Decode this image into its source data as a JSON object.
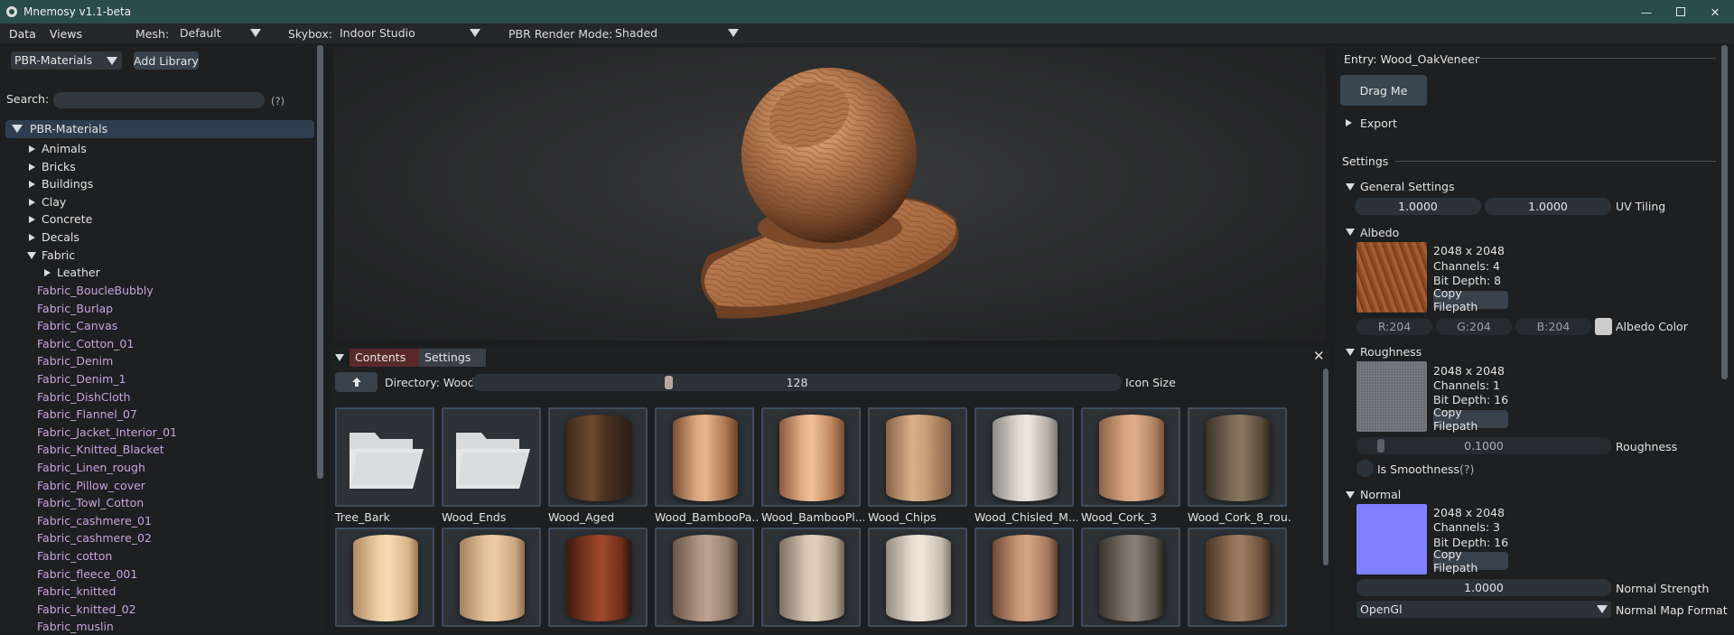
{
  "window": {
    "title": "Mnemosy v1.1-beta"
  },
  "menubar": {
    "data_label": "Data",
    "views_label": "Views",
    "mesh_label": "Mesh:",
    "mesh_value": "Default",
    "skybox_label": "Skybox:",
    "skybox_value": "Indoor Studio",
    "render_mode_label": "PBR Render Mode:",
    "render_mode_value": "Shaded"
  },
  "left": {
    "library_value": "PBR-Materials",
    "add_library_label": "Add Library",
    "search_label": "Search:",
    "search_value": "",
    "help_label": "(?)",
    "root": "PBR-Materials",
    "folders": [
      "Animals",
      "Bricks",
      "Buildings",
      "Clay",
      "Concrete",
      "Decals",
      "Fabric"
    ],
    "subfolder": "Leather",
    "entries": [
      "Fabric_BoucleBubbly",
      "Fabric_Burlap",
      "Fabric_Canvas",
      "Fabric_Cotton_01",
      "Fabric_Denim",
      "Fabric_Denim_1",
      "Fabric_DishCloth",
      "Fabric_Flannel_07",
      "Fabric_Jacket_Interior_01",
      "Fabric_Knitted_Blacket",
      "Fabric_Linen_rough",
      "Fabric_Pillow_cover",
      "Fabric_Towl_Cotton",
      "Fabric_cashmere_01",
      "Fabric_cashmere_02",
      "Fabric_cotton",
      "Fabric_fleece_001",
      "Fabric_knitted",
      "Fabric_knitted_02",
      "Fabric_muslin"
    ]
  },
  "browser": {
    "tab_contents": "Contents",
    "tab_settings": "Settings",
    "directory_label": "Directory: Wood",
    "icon_size_value": "128",
    "icon_size_label": "Icon Size",
    "row1": [
      "Tree_Bark",
      "Wood_Ends",
      "Wood_Aged",
      "Wood_BambooPa...",
      "Wood_BambooPl...",
      "Wood_Chips",
      "Wood_Chisled_M...",
      "Wood_Cork_3",
      "Wood_Cork_8_rou..."
    ]
  },
  "right": {
    "entry_label": "Entry: Wood_OakVeneer",
    "drag_label": "Drag Me",
    "export_label": "Export",
    "settings_label": "Settings",
    "general_label": "General Settings",
    "uv_x": "1.0000",
    "uv_y": "1.0000",
    "uv_label": "UV Tiling",
    "albedo": {
      "label": "Albedo",
      "res": "2048 x 2048",
      "channels": "Channels: 4",
      "depth": "Bit Depth: 8",
      "copy": "Copy Filepath",
      "r": "R:204",
      "g": "G:204",
      "b": "B:204",
      "color_label": "Albedo Color"
    },
    "roughness": {
      "label": "Roughness",
      "res": "2048 x 2048",
      "channels": "Channels: 1",
      "depth": "Bit Depth: 16",
      "copy": "Copy Filepath",
      "value": "0.1000",
      "value_label": "Roughness",
      "smooth_label": "Is Smoothness",
      "help": "(?)",
      "slider_level": 0.1
    },
    "normal": {
      "label": "Normal",
      "res": "2048 x 2048",
      "channels": "Channels: 3",
      "depth": "Bit Depth: 16",
      "copy": "Copy Filepath",
      "strength": "1.0000",
      "strength_label": "Normal Strength",
      "format": "OpenGl",
      "format_label": "Normal Map Format"
    }
  },
  "colors": {
    "titlebar": "#2a4c4a",
    "accent_tab": "#5a2a2a",
    "tab_inactive": "#3a4048",
    "normal_map": "#7f7fff"
  }
}
